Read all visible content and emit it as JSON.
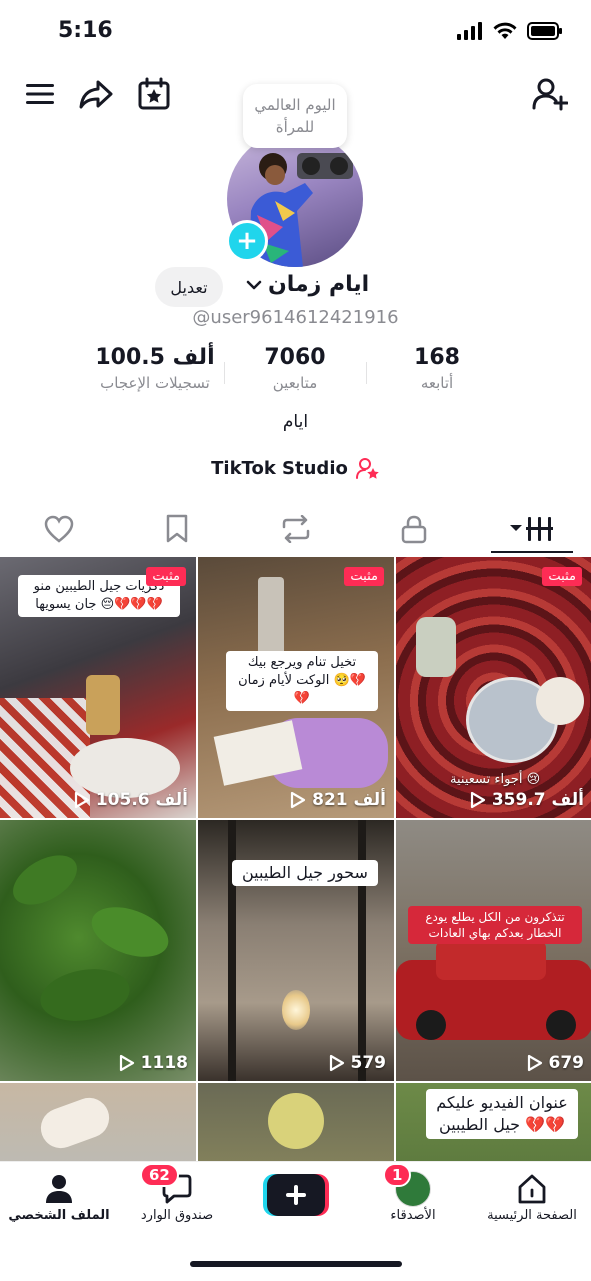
{
  "status_bar": {
    "time": "5:16"
  },
  "note": {
    "text": "اليوم العالمي للمرأة"
  },
  "profile": {
    "display_name": "ايام زمان",
    "handle": "@user9614612421916",
    "edit_label": "تعديل",
    "bio": "ايام",
    "studio_label": "TikTok Studio"
  },
  "stats": {
    "likes": {
      "value": "100.5 ألف",
      "label": "تسجيلات الإعجاب"
    },
    "followers": {
      "value": "7060",
      "label": "متابعين"
    },
    "following": {
      "value": "168",
      "label": "أتابعه"
    }
  },
  "videos": [
    {
      "pinned": "مثبت",
      "views": "105.6 ألف",
      "caption": "ذكريات جيل الطيبين منو جان يسويها 😔💔💔💔"
    },
    {
      "pinned": "مثبت",
      "views": "821 ألف",
      "caption": "تخيل تنام ويرجع بيك الوكت لأيام زمان 🥺💔💔"
    },
    {
      "pinned": "مثبت",
      "views": "359.7 ألف",
      "caption": "أجواء تسعينية 😢"
    },
    {
      "views": "1118"
    },
    {
      "views": "579",
      "caption": "سحور جيل الطيبين"
    },
    {
      "views": "679",
      "caption": "تتذكرون من الكل يطلع يودع الخطار بعدكم بهاي العادات"
    },
    {},
    {},
    {
      "caption": "عنوان الفيديو عليكم جيل الطيبين 💔💔"
    }
  ],
  "bottom_nav": {
    "home": "الصفحة الرئيسية",
    "friends": "الأصدقاء",
    "inbox": "صندوق الوارد",
    "profile": "الملف الشخصي",
    "friends_badge": "1",
    "inbox_badge": "62"
  },
  "colors": {
    "accent": "#fe2c55",
    "cyan": "#20d5ec"
  }
}
